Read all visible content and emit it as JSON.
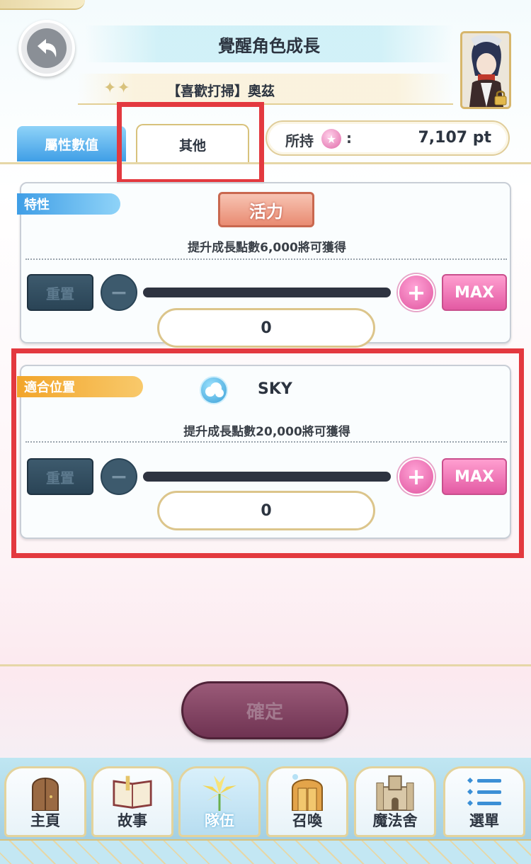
{
  "header": {
    "title": "覺醒角色成長",
    "stars": "✦✦",
    "character_name": "【喜歡打掃】奧茲"
  },
  "tabs": [
    {
      "label": "屬性數值"
    },
    {
      "label": "其他"
    }
  ],
  "points": {
    "label": "所持",
    "colon": ":",
    "value": "7,107 pt",
    "coin_glyph": "★"
  },
  "panels": {
    "trait": {
      "tag": "特性",
      "badge": "活力",
      "description": "提升成長點數6,000將可獲得",
      "reset_label": "重置",
      "minus": "−",
      "plus": "+",
      "max_label": "MAX",
      "value": "0"
    },
    "position": {
      "tag": "適合位置",
      "label": "SKY",
      "description": "提升成長點數20,000將可獲得",
      "reset_label": "重置",
      "minus": "−",
      "plus": "+",
      "max_label": "MAX",
      "value": "0"
    }
  },
  "confirm_label": "確定",
  "nav": [
    {
      "label": "主頁",
      "icon": "door-icon"
    },
    {
      "label": "故事",
      "icon": "book-icon"
    },
    {
      "label": "隊伍",
      "icon": "lily-icon"
    },
    {
      "label": "召喚",
      "icon": "gate-icon"
    },
    {
      "label": "魔法舍",
      "icon": "castle-icon"
    },
    {
      "label": "選單",
      "icon": "menu-icon"
    }
  ],
  "colors": {
    "highlight": "#e3393f",
    "tab_active_blue": "#3f9ee6",
    "accent_pink": "#e35aa3",
    "confirm": "#7a3b5d"
  }
}
